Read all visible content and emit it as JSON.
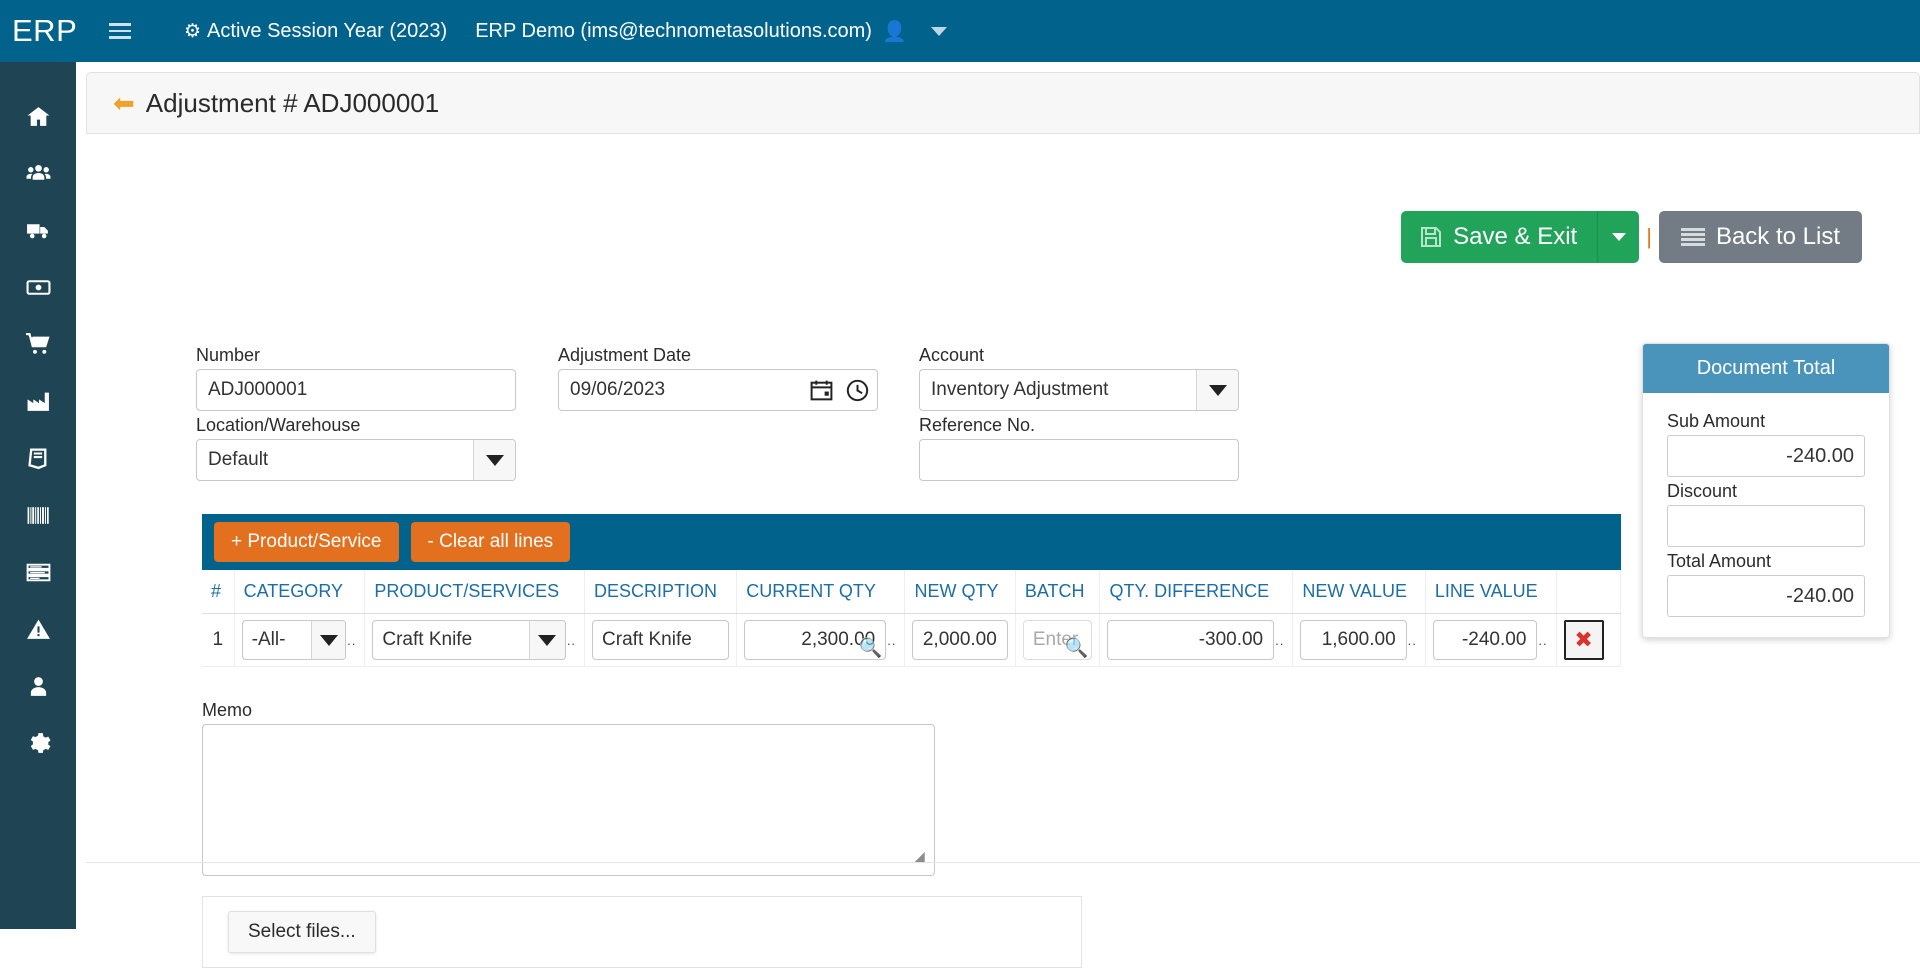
{
  "topbar": {
    "brand": "ERP",
    "menu_icon": "hamburger-icon",
    "session_gear_icon": "gear-icon",
    "session_label": "Active Session Year (2023)",
    "user_label": "ERP Demo (ims@technometasolutions.com)",
    "user_icon": "user-avatar-icon",
    "caret_icon": "chevron-down-icon",
    "background": "#01628C"
  },
  "sidebar": {
    "background": "#1F4454",
    "items": [
      {
        "icon": "home-icon",
        "name": "home"
      },
      {
        "icon": "users-icon",
        "name": "customers"
      },
      {
        "icon": "truck-icon",
        "name": "shipping"
      },
      {
        "icon": "money-bill-icon",
        "name": "finance"
      },
      {
        "icon": "shopping-cart-icon",
        "name": "sales"
      },
      {
        "icon": "factory-icon",
        "name": "manufacturing"
      },
      {
        "icon": "book-icon",
        "name": "ledger"
      },
      {
        "icon": "barcode-icon",
        "name": "inventory"
      },
      {
        "icon": "list-lines-icon",
        "name": "reports"
      },
      {
        "icon": "warning-icon",
        "name": "alerts"
      },
      {
        "icon": "user-icon",
        "name": "account"
      },
      {
        "icon": "gear-icon",
        "name": "settings"
      }
    ]
  },
  "page": {
    "back_icon": "back-arrow-icon",
    "title": "Adjustment # ADJ000001"
  },
  "actions": {
    "save_icon": "floppy-disk-icon",
    "save_label": "Save & Exit",
    "save_caret_icon": "chevron-down-icon",
    "separator": "|",
    "back_icon": "list-icon",
    "back_label": "Back to List",
    "save_color": "#22A35A",
    "back_color": "#737B84"
  },
  "form": {
    "number": {
      "label": "Number",
      "value": "ADJ000001"
    },
    "adjustment_date": {
      "label": "Adjustment Date",
      "value": "09/06/2023",
      "calendar_icon": "calendar-icon",
      "clock_icon": "clock-icon"
    },
    "account": {
      "label": "Account",
      "value": "Inventory Adjustment"
    },
    "location": {
      "label": "Location/Warehouse",
      "value": "Default"
    },
    "reference_no": {
      "label": "Reference No.",
      "value": "",
      "placeholder": ""
    }
  },
  "document_total": {
    "title": "Document Total",
    "header_color": "#4A93BB",
    "sub_amount": {
      "label": "Sub Amount",
      "value": "-240.00"
    },
    "discount": {
      "label": "Discount",
      "value": ""
    },
    "total_amount": {
      "label": "Total Amount",
      "value": "-240.00"
    }
  },
  "grid": {
    "toolbar": {
      "add_label": "+ Product/Service",
      "clear_label": "- Clear all lines",
      "bar_color": "#01628C",
      "button_color": "#E2701E"
    },
    "columns": [
      "#",
      "CATEGORY",
      "PRODUCT/SERVICES",
      "DESCRIPTION",
      "CURRENT QTY",
      "NEW QTY",
      "BATCH",
      "QTY. DIFFERENCE",
      "NEW VALUE",
      "LINE VALUE",
      ""
    ],
    "rows": [
      {
        "num": "1",
        "category": "-All-",
        "product": "Craft Knife",
        "description": "Craft Knife",
        "current_qty": "2,300.00",
        "new_qty": "2,000.00",
        "batch": "",
        "batch_placeholder": "Enter B",
        "qty_difference": "-300.00",
        "new_value": "1,600.00",
        "line_value": "-240.00",
        "delete_icon": "close-x-icon",
        "delete_label": "✖"
      }
    ],
    "search_icon": "magnifier-icon",
    "ellipsis": ".."
  },
  "memo": {
    "label": "Memo",
    "value": "",
    "placeholder": ""
  },
  "attachments": {
    "select_files_label": "Select files..."
  }
}
